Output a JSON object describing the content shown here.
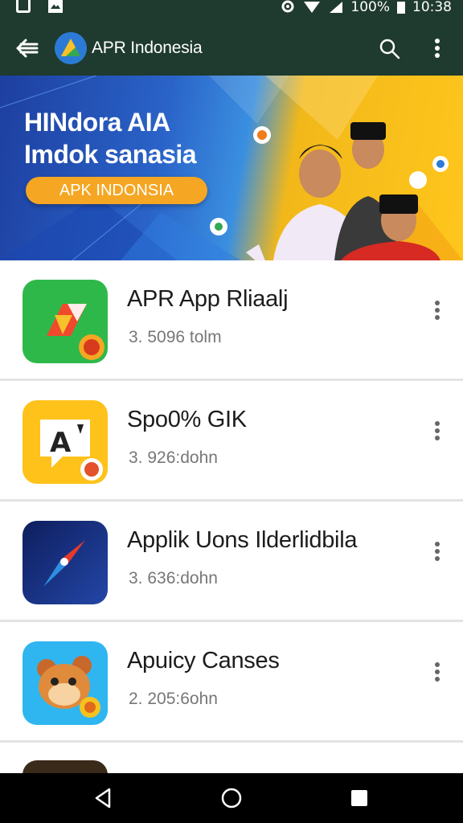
{
  "status_bar": {
    "battery": "100%",
    "time": "10:38"
  },
  "app_bar": {
    "title": "APR Indonesia",
    "icons": [
      "back-arrow-icon",
      "app-logo",
      "search-icon",
      "more-vert-icon"
    ]
  },
  "banner": {
    "headline_line1": "HINdora AIA",
    "headline_line2": "Imdok sanasia",
    "pill_label": "APK INDONSIA",
    "colors": {
      "left": "#1d3fa0",
      "right": "#ffc61c",
      "pill": "#f5a623"
    }
  },
  "apps": [
    {
      "title": "APR App Rliaalj",
      "subtitle": "3. 5096 tolm",
      "icon": "green-arrow-app-icon",
      "icon_color": "#2fb84a"
    },
    {
      "title": "Spo0% GIK",
      "subtitle": "3. 926:dohn",
      "icon": "letter-a-chat-icon",
      "icon_color": "#ffc21a"
    },
    {
      "title": "Applik Uons Ilderlidbila",
      "subtitle": "3. 636:dohn",
      "icon": "compass-icon",
      "icon_color": "#1b2f7a"
    },
    {
      "title": "Apuicy Canses",
      "subtitle": "2. 205:6ohn",
      "icon": "cartoon-monkey-icon",
      "icon_color": "#2fb6f0"
    }
  ],
  "nav_bar": {
    "icons": [
      "nav-back-icon",
      "nav-home-icon",
      "nav-recents-icon"
    ]
  }
}
